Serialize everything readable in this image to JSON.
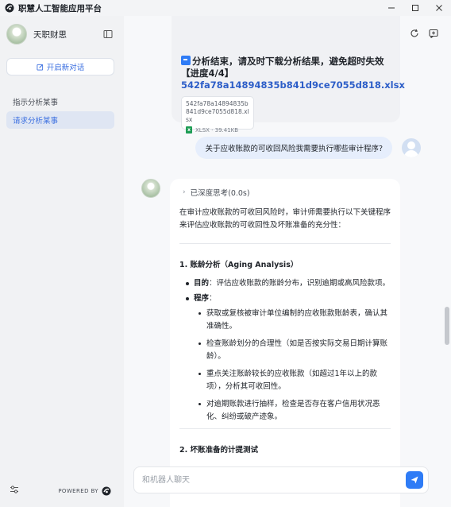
{
  "window": {
    "title": "职慧人工智能应用平台",
    "controls": [
      "minimize-icon",
      "maximize-icon",
      "close-icon"
    ]
  },
  "sidebar": {
    "brand_name": "天职财思",
    "new_chat_label": "开启新对话",
    "conversations": [
      {
        "label": "指示分析某事",
        "active": false
      },
      {
        "label": "请求分析某事",
        "active": true
      }
    ],
    "powered_by": "POWERED BY"
  },
  "chat": {
    "prev_message": {
      "text_before_link": "分析结束，请及时下载分析结果，避免超时失效【进度4/4】",
      "link_text": "542fa78a14894835b841d9ce7055d818.xlsx",
      "file": {
        "name": "542fa78a14894835b841d9ce7055d818.xlsx",
        "type": "XLSX",
        "size": "39.41KB"
      }
    },
    "user_message": "关于应收账款的可收回风险我需要执行哪些审计程序?",
    "bot_message": {
      "think_label": "已深度思考(0.0s)",
      "intro": "在审计应收账款的可收回风险时，审计师需要执行以下关键程序来评估应收账款的可收回性及坏账准备的充分性：",
      "sections": [
        {
          "title": "1. 账龄分析（Aging Analysis）",
          "goal_label": "目的",
          "goal_text": "：评估应收账款的账龄分布，识别逾期或高风险款项。",
          "proc_label": "程序",
          "proc_colon": "：",
          "steps": [
            "获取或复核被审计单位编制的应收账款账龄表，确认其准确性。",
            "检查账龄划分的合理性（如是否按实际交易日期计算账龄）。",
            "重点关注账龄较长的应收账款（如超过1年以上的款项），分析其可收回性。",
            "对逾期账款进行抽样，检查是否存在客户信用状况恶化、纠纷或破产迹象。"
          ]
        },
        {
          "title": "2. 坏账准备的计提测试"
        }
      ]
    }
  },
  "input": {
    "placeholder": "和机器人聊天"
  },
  "colors": {
    "accent": "#2f7cf6",
    "link": "#2d5ec8",
    "active_item_bg": "#dfe6f3",
    "user_bubble": "#e6eefc",
    "sidebar_bg": "#f1f2f4"
  }
}
